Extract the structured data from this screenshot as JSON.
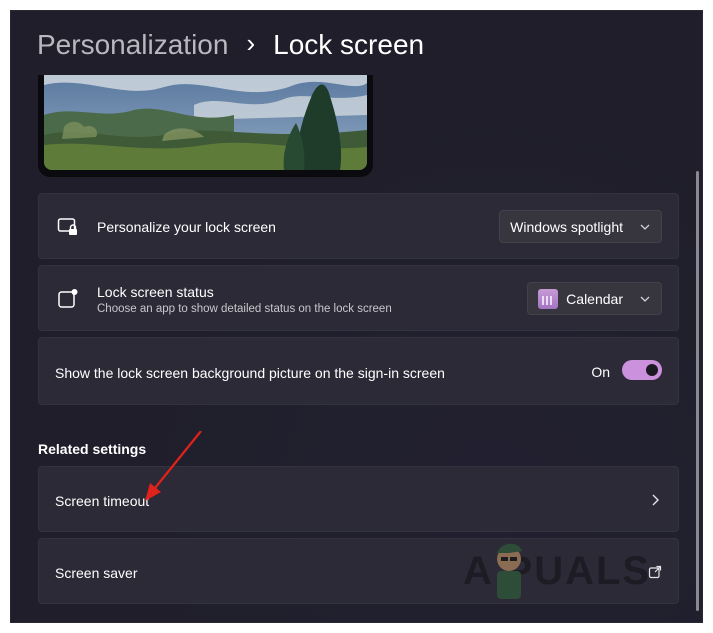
{
  "breadcrumb": {
    "parent": "Personalization",
    "separator": "›",
    "current": "Lock screen"
  },
  "personalize": {
    "title": "Personalize your lock screen",
    "dropdown_value": "Windows spotlight"
  },
  "status": {
    "title": "Lock screen status",
    "subtitle": "Choose an app to show detailed status on the lock screen",
    "dropdown_value": "Calendar"
  },
  "signin_background": {
    "title": "Show the lock screen background picture on the sign-in screen",
    "toggle_label": "On",
    "toggle_on": true
  },
  "related": {
    "title": "Related settings",
    "items": [
      {
        "label": "Screen timeout",
        "icon": "chevron-right-icon"
      },
      {
        "label": "Screen saver",
        "icon": "external-link-icon"
      }
    ]
  },
  "watermark": "A  PUALS",
  "colors": {
    "background": "#1f1e2a",
    "card": "#2b2a36",
    "accent": "#cc91dd",
    "annotation_arrow": "#e0221c"
  }
}
